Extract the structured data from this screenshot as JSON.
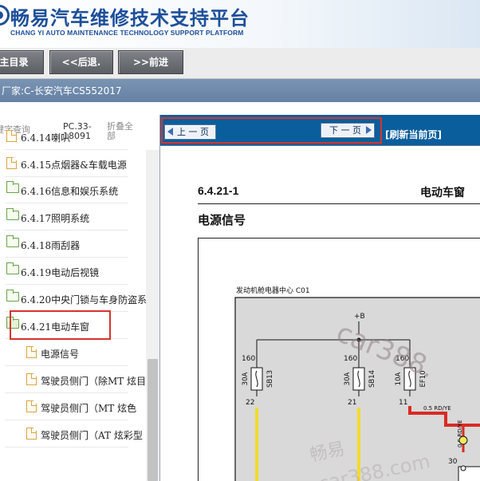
{
  "header": {
    "title": "畅易汽车维修技术支持平台",
    "subtitle": "CHANG YI AUTO MAINTENANCE TECHNOLOGY SUPPORT PLATFORM"
  },
  "toolbar": {
    "main_menu": "主目录",
    "back": "<<后退.",
    "forward": ">>前进"
  },
  "vendor_bar": {
    "text": "厂家:C-长安汽车CS552017"
  },
  "left_panel": {
    "tabs": {
      "keyword_search": "键字查询",
      "pc_code": "PC.33-18091",
      "collapse_all": "折叠全部"
    },
    "tree": [
      {
        "label": "6.4.14喇叭",
        "icon": "document-icon"
      },
      {
        "label": "6.4.15点烟器&车载电源",
        "icon": "document-icon"
      },
      {
        "label": "6.4.16信息和娱乐系统",
        "icon": "folder-icon"
      },
      {
        "label": "6.4.17照明系统",
        "icon": "folder-icon"
      },
      {
        "label": "6.4.18雨刮器",
        "icon": "folder-icon"
      },
      {
        "label": "6.4.19电动后视镜",
        "icon": "folder-icon"
      },
      {
        "label": "6.4.20中央门锁与车身防盗系",
        "icon": "folder-icon"
      },
      {
        "label": "6.4.21电动车窗",
        "icon": "folder-open-icon",
        "selected": true
      },
      {
        "label": "电源信号",
        "icon": "document-icon"
      },
      {
        "label": "驾驶员侧门（除MT 炫目",
        "icon": "document-icon"
      },
      {
        "label": "驾驶员侧门（MT 炫色",
        "icon": "document-icon"
      },
      {
        "label": "驾驶员侧门（AT 炫彩型",
        "icon": "document-icon"
      }
    ]
  },
  "content": {
    "nav": {
      "prev": "上 一 页",
      "next": "下 一 页",
      "refresh": "[刷新当前页]"
    },
    "doc": {
      "section": "6.4.21-1",
      "title": "电动车窗",
      "subtitle": "电源信号"
    },
    "diagram": {
      "fuse_box_label": "发动机舱电器中心 C01",
      "battery_label": "+B",
      "fuses": [
        {
          "top_num": "160",
          "rating": "30A",
          "name": "SB13",
          "pin": "22"
        },
        {
          "top_num": "160",
          "rating": "30A",
          "name": "SB14",
          "pin": "21"
        },
        {
          "top_num": "160",
          "rating": "10A",
          "name": "EF10",
          "pin": "11"
        }
      ],
      "wire_label_1": "0.5 RD/YE",
      "wire_label_2": "0.5 RD/YE",
      "connector_pin": "30",
      "watermarks": [
        "car388.",
        "畅易",
        "car388.com"
      ]
    }
  }
}
